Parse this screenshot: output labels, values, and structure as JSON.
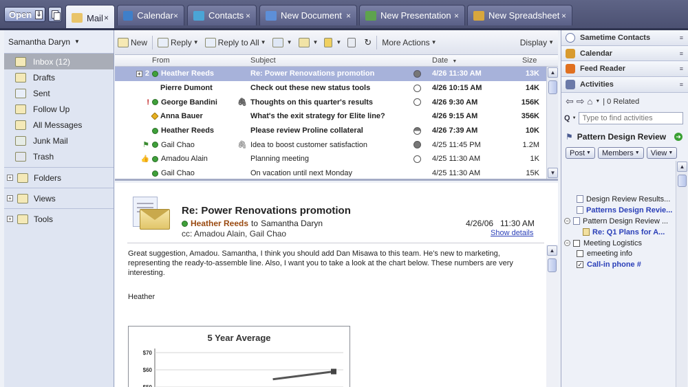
{
  "topbar": {
    "open_label": "Open",
    "tabs": [
      {
        "label": "Mail",
        "active": true,
        "color": "#e9c46a"
      },
      {
        "label": "Calendar",
        "active": false,
        "color": "#3f7fc9"
      },
      {
        "label": "Contacts",
        "active": false,
        "color": "#4aa5d6"
      },
      {
        "label": "New Document",
        "active": false,
        "color": "#5d8fd8"
      },
      {
        "label": "New Presentation",
        "active": false,
        "color": "#5ea34d"
      },
      {
        "label": "New Spreadsheet",
        "active": false,
        "color": "#d8a73d"
      }
    ],
    "close_glyph": "×"
  },
  "leftnav": {
    "user": "Samantha Daryn",
    "items": [
      {
        "label": "Inbox (12)",
        "selected": true
      },
      {
        "label": "Drafts",
        "selected": false
      },
      {
        "label": "Sent",
        "selected": false
      },
      {
        "label": "Follow Up",
        "selected": false
      },
      {
        "label": "All Messages",
        "selected": false
      },
      {
        "label": "Junk Mail",
        "selected": false
      },
      {
        "label": "Trash",
        "selected": false
      }
    ],
    "sections": [
      "Folders",
      "Views",
      "Tools"
    ]
  },
  "toolbar": {
    "new_label": "New",
    "reply_label": "Reply",
    "reply_all_label": "Reply to All",
    "more_actions_label": "More Actions",
    "display_label": "Display"
  },
  "list": {
    "headers": {
      "from": "From",
      "subject": "Subject",
      "date": "Date",
      "size": "Size"
    },
    "rows": [
      {
        "thread": "2",
        "mark": "",
        "presence": "online",
        "from": "Heather Reeds",
        "attach": false,
        "subject": "Re: Power Renovations promotion",
        "status": "full",
        "date": "4/26 11:30 AM",
        "size": "13K",
        "bold": true,
        "selected": true
      },
      {
        "thread": "",
        "mark": "",
        "presence": "none",
        "from": "Pierre Dumont",
        "attach": false,
        "subject": "Check out these new status tools",
        "status": "empty",
        "date": "4/26 10:15 AM",
        "size": "14K",
        "bold": true,
        "selected": false
      },
      {
        "thread": "",
        "mark": "!",
        "presence": "online",
        "from": "George Bandini",
        "attach": true,
        "subject": "Thoughts on this quarter's results",
        "status": "empty",
        "date": "4/26 9:30 AM",
        "size": "156K",
        "bold": true,
        "selected": false
      },
      {
        "thread": "",
        "mark": "",
        "presence": "away",
        "from": "Anna Bauer",
        "attach": false,
        "subject": "What's the exit strategy for Elite line?",
        "status": "none",
        "date": "4/26 9:15 AM",
        "size": "356K",
        "bold": true,
        "selected": false
      },
      {
        "thread": "",
        "mark": "",
        "presence": "online",
        "from": "Heather Reeds",
        "attach": false,
        "subject": "Please review Proline collateral",
        "status": "half",
        "date": "4/26 7:39 AM",
        "size": "10K",
        "bold": true,
        "selected": false
      },
      {
        "thread": "",
        "mark": "flag",
        "presence": "online",
        "from": "Gail Chao",
        "attach": true,
        "subject": "Idea to boost customer satisfaction",
        "status": "full",
        "date": "4/25 11:45 PM",
        "size": "1.2M",
        "bold": false,
        "selected": false
      },
      {
        "thread": "",
        "mark": "thumb",
        "presence": "online",
        "from": "Amadou Alain",
        "attach": false,
        "subject": "Planning meeting",
        "status": "empty",
        "date": "4/25 11:30 AM",
        "size": "1K",
        "bold": false,
        "selected": false
      },
      {
        "thread": "",
        "mark": "",
        "presence": "online",
        "from": "Gail Chao",
        "attach": false,
        "subject": "On vacation until next Monday",
        "status": "none",
        "date": "4/25 11:30 AM",
        "size": "15K",
        "bold": false,
        "selected": false
      }
    ]
  },
  "reader": {
    "subject": "Re: Power Renovations promotion",
    "from": "Heather Reeds",
    "to_word": "to",
    "to": "Samantha Daryn",
    "cc": "cc: Amadou Alain, Gail Chao",
    "date": "4/26/06",
    "time": "11:30 AM",
    "show_details": "Show details",
    "body": "Great suggestion, Amadou.  Samantha, I think you should add Dan Misawa to this team.  He's new to marketing, representing the ready-to-assemble line.  Also, I want you to take a look at the chart below.  These numbers are very interesting.",
    "signature": "Heather",
    "chart_title": "5 Year Average"
  },
  "chart_data": {
    "type": "line",
    "title": "5 Year Average",
    "yticks": [
      "$70",
      "$60",
      "$50"
    ],
    "ylim": [
      50,
      70
    ],
    "series": [
      {
        "name": "",
        "points": [
          [
            0.66,
            54.5
          ],
          [
            1.0,
            59
          ]
        ]
      }
    ]
  },
  "sidebar": {
    "panels": [
      "Sametime Contacts",
      "Calendar",
      "Feed Reader",
      "Activities"
    ],
    "panel_colors": [
      "#6c7aa8",
      "#d89a2e",
      "#e07020",
      "#6c7aa8"
    ],
    "related": "| 0 Related",
    "find_placeholder": "Type to find activities",
    "activity_title": "Pattern Design Review",
    "buttons": [
      "Post",
      "Members",
      "View"
    ],
    "tree": [
      {
        "label": "Design Review Results...",
        "kind": "doc",
        "toggle": "",
        "link": false,
        "indent": 2
      },
      {
        "label": "Patterns Design Revie...",
        "kind": "doc",
        "toggle": "",
        "link": true,
        "indent": 2
      },
      {
        "label": "Pattern Design Review ...",
        "kind": "doc",
        "toggle": "−",
        "link": false,
        "indent": 0
      },
      {
        "label": "Re: Q1 Plans for A...",
        "kind": "folder",
        "toggle": "",
        "link": true,
        "indent": 3
      },
      {
        "label": "Meeting Logistics",
        "kind": "check",
        "toggle": "−",
        "link": false,
        "indent": 0,
        "checked": false
      },
      {
        "label": "emeeting info",
        "kind": "check",
        "toggle": "",
        "link": false,
        "indent": 2,
        "checked": false
      },
      {
        "label": "Call-in phone #",
        "kind": "check",
        "toggle": "",
        "link": true,
        "indent": 2,
        "checked": true
      }
    ]
  }
}
